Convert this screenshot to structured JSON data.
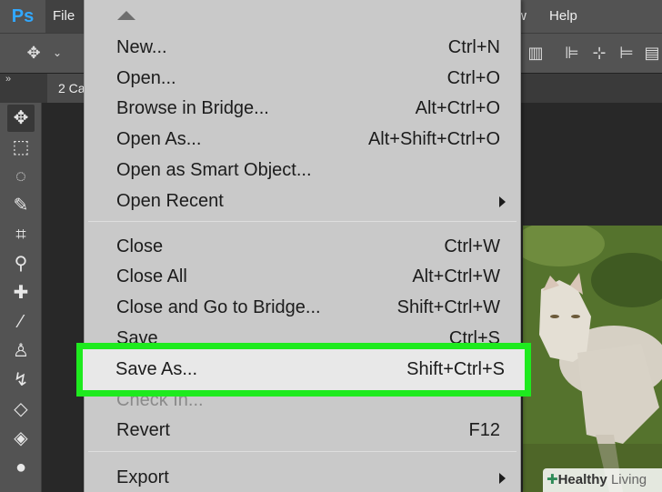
{
  "app": {
    "logo": "Ps"
  },
  "menubar": {
    "file": "File",
    "window_fragment": "w",
    "help": "Help"
  },
  "document": {
    "tab_title": "2 Ca"
  },
  "file_menu": {
    "items_group1": [
      {
        "label": "New...",
        "shortcut": "Ctrl+N"
      },
      {
        "label": "Open...",
        "shortcut": "Ctrl+O"
      },
      {
        "label": "Browse in Bridge...",
        "shortcut": "Alt+Ctrl+O"
      },
      {
        "label": "Open As...",
        "shortcut": "Alt+Shift+Ctrl+O"
      },
      {
        "label": "Open as Smart Object...",
        "shortcut": ""
      },
      {
        "label": "Open Recent",
        "shortcut": ""
      }
    ],
    "items_group2": [
      {
        "label": "Close",
        "shortcut": "Ctrl+W"
      },
      {
        "label": "Close All",
        "shortcut": "Alt+Ctrl+W"
      },
      {
        "label": "Close and Go to Bridge...",
        "shortcut": "Shift+Ctrl+W"
      },
      {
        "label": "Save",
        "shortcut": "Ctrl+S"
      },
      {
        "label": "Save As...",
        "shortcut": "Shift+Ctrl+S"
      },
      {
        "label": "Check In...",
        "shortcut": ""
      },
      {
        "label": "Revert",
        "shortcut": "F12"
      }
    ],
    "items_group3": [
      {
        "label": "Export",
        "shortcut": ""
      }
    ]
  },
  "highlight_color": "#1eea1e",
  "watermark": {
    "brand": "Healthy",
    "suffix": "Living"
  }
}
